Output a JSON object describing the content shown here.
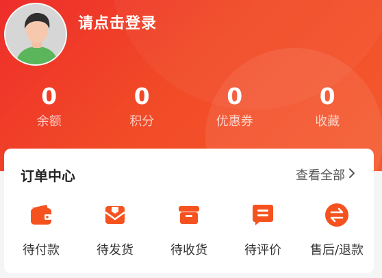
{
  "header": {
    "login_text": "请点击登录",
    "avatar_icon": "user-avatar-icon"
  },
  "stats": [
    {
      "value": "0",
      "label": "余额"
    },
    {
      "value": "0",
      "label": "积分"
    },
    {
      "value": "0",
      "label": "优惠券"
    },
    {
      "value": "0",
      "label": "收藏"
    }
  ],
  "orders": {
    "title": "订单中心",
    "view_all": "查看全部",
    "chevron_icon": "chevron-right-icon",
    "items": [
      {
        "label": "待付款",
        "icon": "wallet-icon"
      },
      {
        "label": "待发货",
        "icon": "package-send-icon"
      },
      {
        "label": "待收货",
        "icon": "box-receive-icon"
      },
      {
        "label": "待评价",
        "icon": "comment-icon"
      },
      {
        "label": "售后/退款",
        "icon": "exchange-icon"
      }
    ]
  },
  "colors": {
    "brand": "#EE2D2A",
    "icon_orange": "#F5521F"
  }
}
